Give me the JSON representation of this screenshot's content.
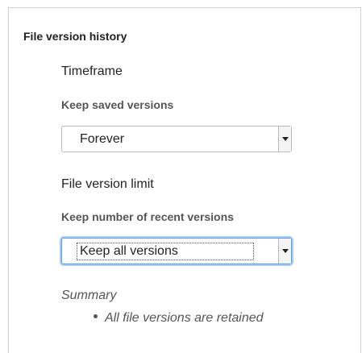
{
  "section": {
    "title": "File version history"
  },
  "timeframe": {
    "heading": "Timeframe",
    "label": "Keep saved versions",
    "selected": "Forever"
  },
  "version_limit": {
    "heading": "File version limit",
    "label": "Keep number of recent versions",
    "selected": "Keep all versions"
  },
  "summary": {
    "title": "Summary",
    "items": [
      "All file versions are retained"
    ]
  },
  "icons": {
    "dropdown": "chevron-down-icon"
  },
  "colors": {
    "focus_border": "#5a9be6",
    "focus_glow": "#a9cdf5"
  }
}
